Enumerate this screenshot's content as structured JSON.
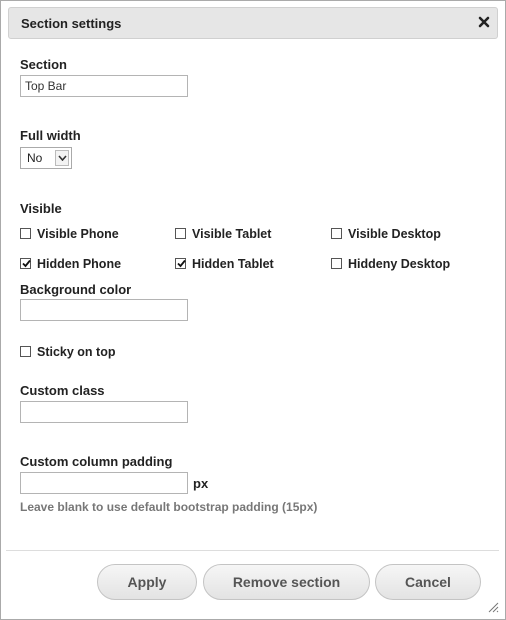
{
  "dialog": {
    "title": "Section settings",
    "close_icon": "close-icon"
  },
  "section": {
    "label": "Section",
    "value": "Top Bar"
  },
  "full_width": {
    "label": "Full width",
    "selected": "No",
    "options": [
      "No"
    ]
  },
  "visible": {
    "label": "Visible",
    "options": [
      {
        "label": "Visible Phone",
        "checked": false
      },
      {
        "label": "Visible Tablet",
        "checked": false
      },
      {
        "label": "Visible Desktop",
        "checked": false
      },
      {
        "label": "Hidden Phone",
        "checked": true
      },
      {
        "label": "Hidden Tablet",
        "checked": true
      },
      {
        "label": "Hiddeny Desktop",
        "checked": false
      }
    ]
  },
  "background_color": {
    "label": "Background color",
    "value": ""
  },
  "sticky": {
    "label": "Sticky on top",
    "checked": false
  },
  "custom_class": {
    "label": "Custom class",
    "value": ""
  },
  "column_padding": {
    "label": "Custom column padding",
    "value": "",
    "unit": "px",
    "help": "Leave blank to use default bootstrap padding (15px)"
  },
  "actions": {
    "apply": "Apply",
    "remove": "Remove section",
    "cancel": "Cancel"
  },
  "colors": {
    "titlebar": "#e6e6e6",
    "button_text": "#555555",
    "help_text": "#777777"
  }
}
